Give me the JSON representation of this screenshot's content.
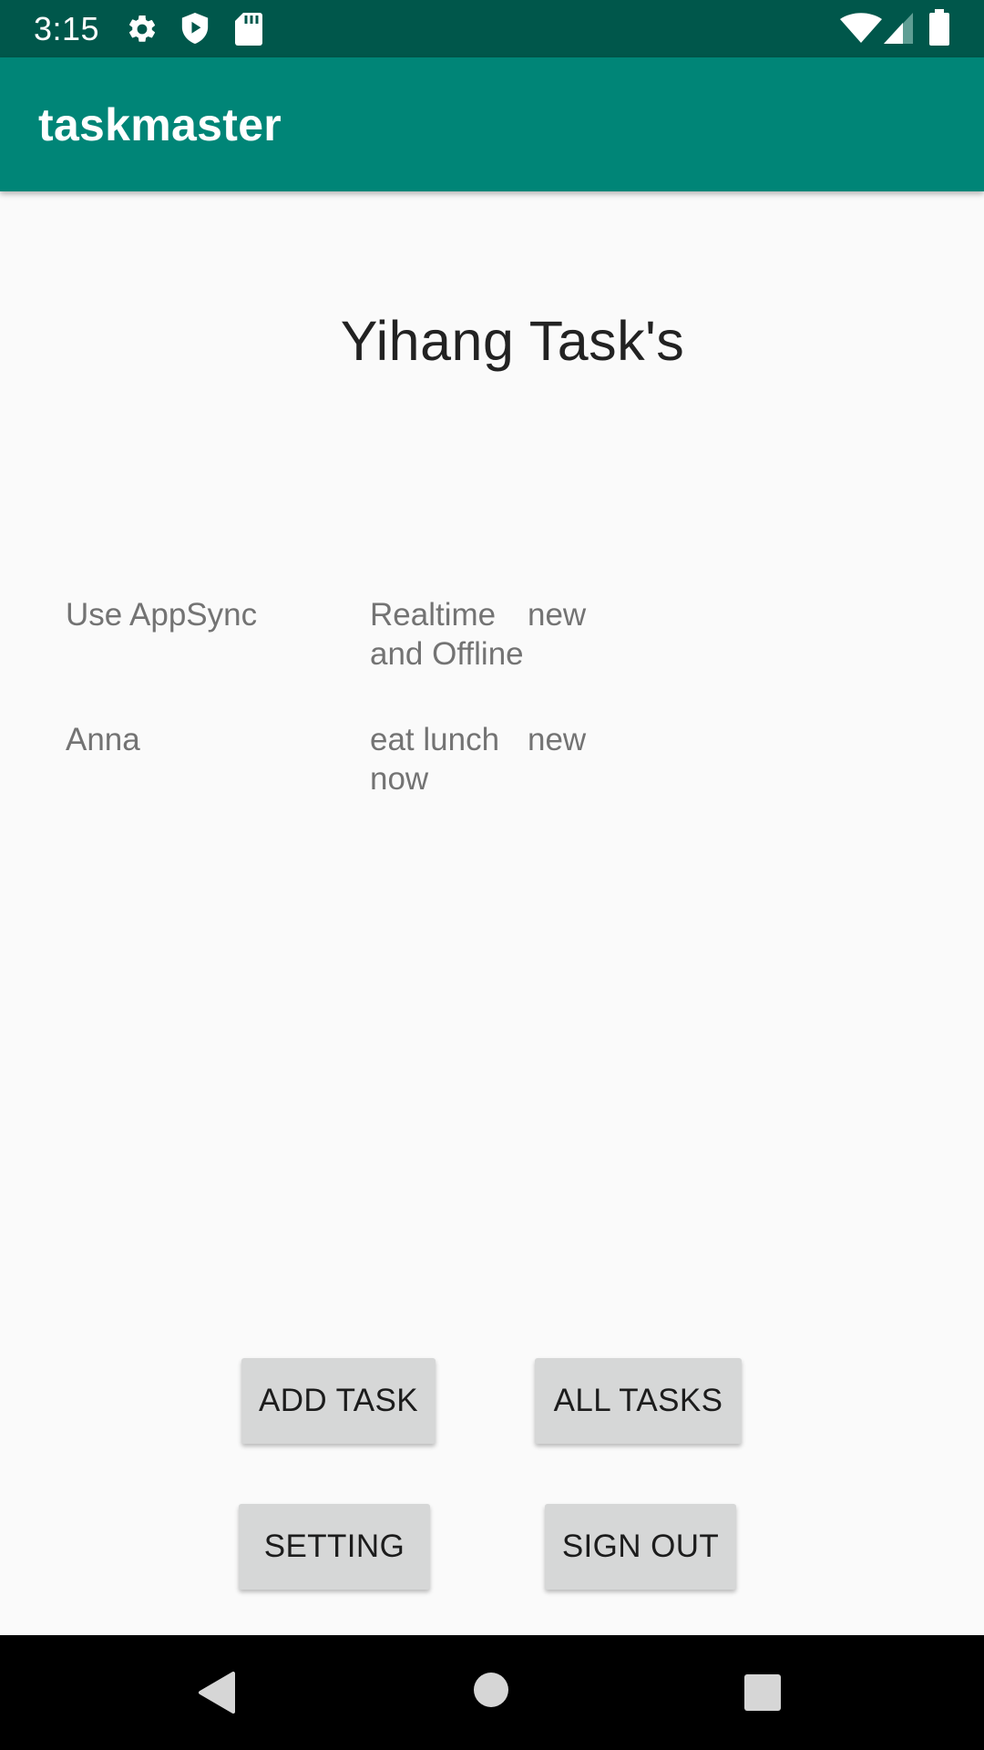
{
  "status_bar": {
    "time": "3:15",
    "icons": [
      "gear-icon",
      "shield-play-icon",
      "sd-card-icon",
      "wifi-icon",
      "cell-signal-icon",
      "battery-icon"
    ]
  },
  "app_bar": {
    "title": "taskmaster",
    "color": "#008577"
  },
  "main": {
    "heading": "Yihang Task's",
    "tasks": [
      {
        "user": "Use AppSync",
        "body": "Realtime and Offline",
        "state": "new"
      },
      {
        "user": "Anna",
        "body": "eat lunch now",
        "state": "new"
      }
    ]
  },
  "buttons": {
    "add_task": "ADD TASK",
    "all_tasks": "ALL TASKS",
    "setting": "SETTING",
    "sign_out": "SIGN OUT"
  },
  "nav_bar": {
    "icons": [
      "back-icon",
      "home-icon",
      "recents-icon"
    ]
  }
}
